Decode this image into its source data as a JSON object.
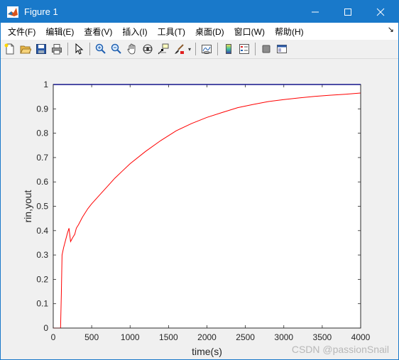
{
  "window": {
    "title": "Figure 1",
    "controls": [
      "minimize",
      "maximize",
      "close"
    ]
  },
  "menu": {
    "items": [
      {
        "label": "文件(F)"
      },
      {
        "label": "编辑(E)"
      },
      {
        "label": "查看(V)"
      },
      {
        "label": "插入(I)"
      },
      {
        "label": "工具(T)"
      },
      {
        "label": "桌面(D)"
      },
      {
        "label": "窗口(W)"
      },
      {
        "label": "帮助(H)"
      }
    ],
    "overflow_glyph": "↘"
  },
  "toolbar": {
    "buttons": [
      "new-figure-icon",
      "open-file-icon",
      "save-icon",
      "print-icon",
      "pointer-icon",
      "zoom-in-icon",
      "zoom-out-icon",
      "pan-hand-icon",
      "rotate-3d-icon",
      "data-cursor-icon",
      "brush-icon",
      "link-plot-icon",
      "colorbar-icon",
      "legend-icon",
      "hide-plot-tools-icon",
      "show-plot-tools-icon"
    ]
  },
  "chart_data": {
    "type": "line",
    "title": "",
    "xlabel": "time(s)",
    "ylabel": "rin,yout",
    "xlim": [
      0,
      4000
    ],
    "ylim": [
      0,
      1
    ],
    "xticks": [
      0,
      500,
      1000,
      1500,
      2000,
      2500,
      3000,
      3500,
      4000
    ],
    "yticks": [
      0,
      0.1,
      0.2,
      0.3,
      0.4,
      0.5,
      0.6,
      0.7,
      0.8,
      0.9,
      1
    ],
    "grid": false,
    "series": [
      {
        "color": "#0000ff",
        "x": [
          0,
          4000
        ],
        "y": [
          1,
          1
        ]
      },
      {
        "color": "#ff0000",
        "x": [
          0,
          95,
          105,
          115,
          135,
          160,
          185,
          205,
          225,
          250,
          280,
          300,
          330,
          380,
          450,
          500,
          600,
          700,
          800,
          900,
          1000,
          1200,
          1400,
          1600,
          1800,
          2000,
          2200,
          2400,
          2600,
          2800,
          3000,
          3200,
          3400,
          3600,
          3800,
          4000
        ],
        "y": [
          0,
          0,
          0.14,
          0.3,
          0.33,
          0.36,
          0.39,
          0.41,
          0.355,
          0.37,
          0.385,
          0.41,
          0.425,
          0.455,
          0.49,
          0.51,
          0.545,
          0.58,
          0.615,
          0.645,
          0.675,
          0.725,
          0.77,
          0.81,
          0.84,
          0.865,
          0.885,
          0.905,
          0.918,
          0.93,
          0.938,
          0.945,
          0.951,
          0.956,
          0.96,
          0.965
        ]
      }
    ]
  },
  "watermark": "CSDN @passionSnail"
}
